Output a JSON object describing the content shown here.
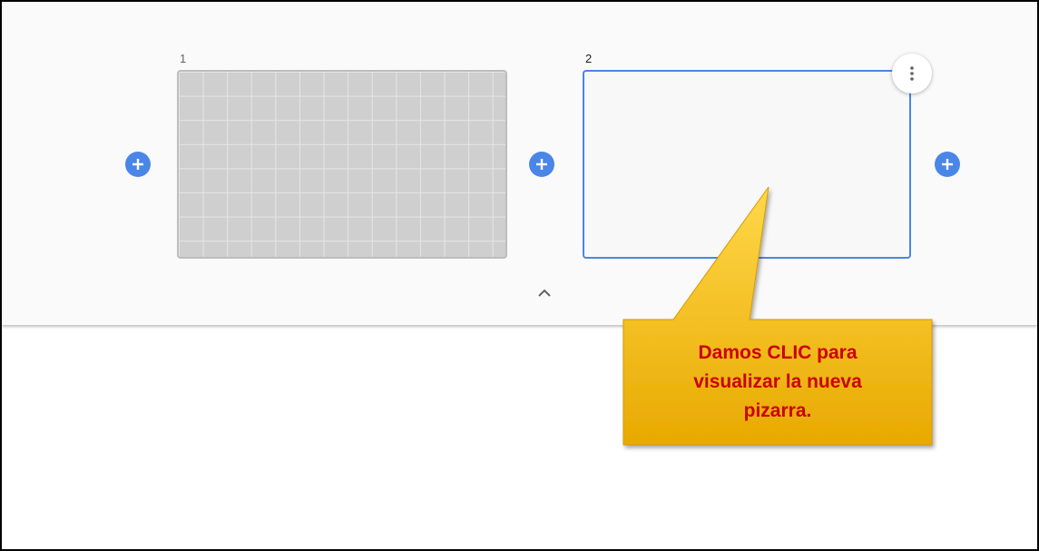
{
  "frames": [
    {
      "number": "1",
      "style": "grid",
      "selected": false
    },
    {
      "number": "2",
      "style": "blank",
      "selected": true
    }
  ],
  "icons": {
    "add": "plus-circle-icon",
    "more": "more-vertical-icon",
    "collapse": "chevron-up-icon"
  },
  "colors": {
    "accent": "#4a86e8",
    "callout_fill": "#f6b800",
    "callout_text": "#cc0000"
  },
  "callout": {
    "text": "Damos CLIC para\nvisualizar la nueva\npizarra."
  }
}
